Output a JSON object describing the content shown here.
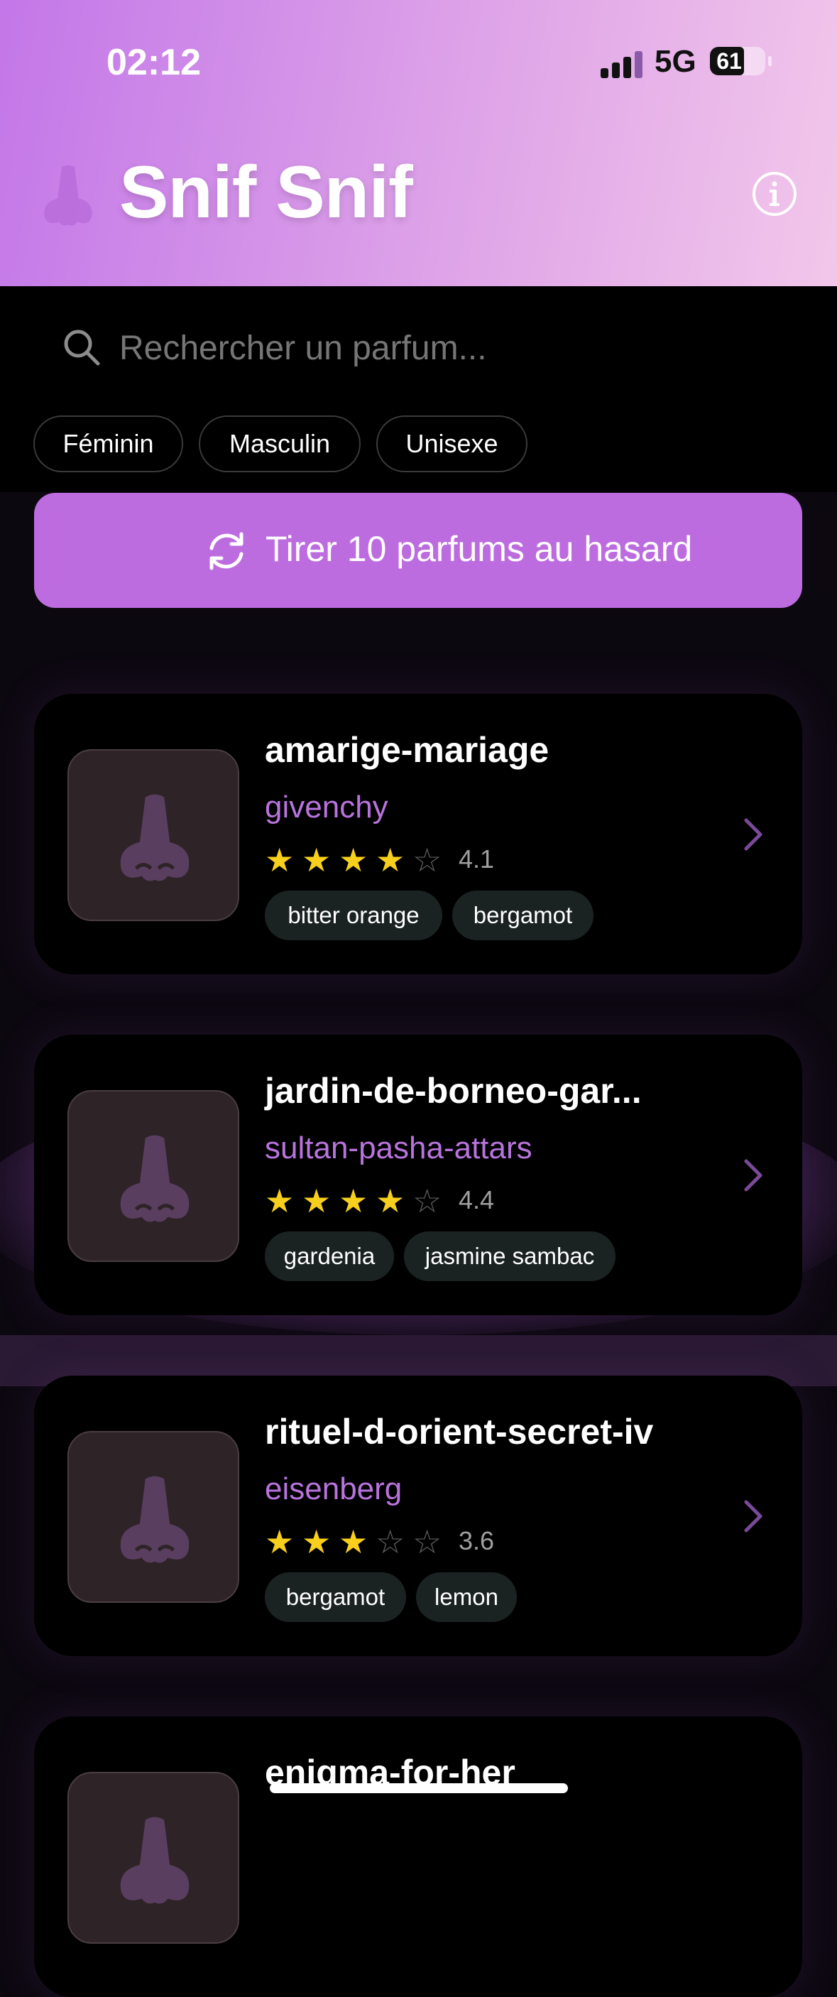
{
  "status_bar": {
    "time": "02:12",
    "network": "5G",
    "battery": "61"
  },
  "header": {
    "app_title": "Snif Snif",
    "logo_icon": "nose-icon",
    "info_icon": "info-icon",
    "accent_colors": [
      "#c377e8",
      "#f2c7ea"
    ]
  },
  "search": {
    "placeholder": "Rechercher un parfum...",
    "value": "",
    "icon": "search-icon"
  },
  "filters": [
    "Féminin",
    "Masculin",
    "Unisexe"
  ],
  "random_button": {
    "label": "Tirer 10 parfums au hasard",
    "icon": "refresh-icon",
    "color": "#bd6ce0"
  },
  "perfumes": [
    {
      "name": "amarige-mariage",
      "brand": "givenchy",
      "stars": 4,
      "rating": "4.1",
      "notes": [
        "bitter orange",
        "bergamot"
      ]
    },
    {
      "name": "jardin-de-borneo-gar...",
      "brand": "sultan-pasha-attars",
      "stars": 4,
      "rating": "4.4",
      "notes": [
        "gardenia",
        "jasmine sambac"
      ]
    },
    {
      "name": "rituel-d-orient-secret-iv",
      "brand": "eisenberg",
      "stars": 3,
      "rating": "3.6",
      "notes": [
        "bergamot",
        "lemon"
      ]
    },
    {
      "name": "enigma-for-her",
      "brand": "",
      "stars": 0,
      "rating": "",
      "notes": []
    }
  ],
  "colors": {
    "brand_text": "#b874dd",
    "star_on": "#f8cf1c",
    "star_off": "#5e5e5e",
    "card_bg": "#000000",
    "tag_bg": "#1b2322"
  }
}
